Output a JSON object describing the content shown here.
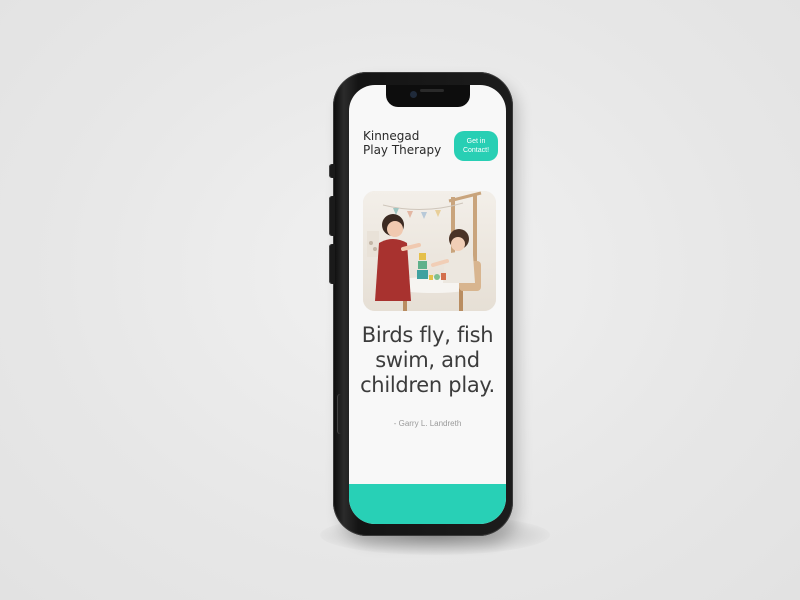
{
  "site": {
    "brand_name": "Kinnegad Play Therapy",
    "cta_label": "Get in Contact!"
  },
  "hero": {
    "image_description": "hero-photo"
  },
  "quote": {
    "text": "Birds fly, fish swim, and children play.",
    "author": "- Garry L. Landreth"
  },
  "colors": {
    "accent": "#28cfb4",
    "text_dark": "#3c3c3c",
    "text_muted": "#9a9a9a",
    "phone_body": "#141414",
    "background": "#e9e9e9"
  }
}
